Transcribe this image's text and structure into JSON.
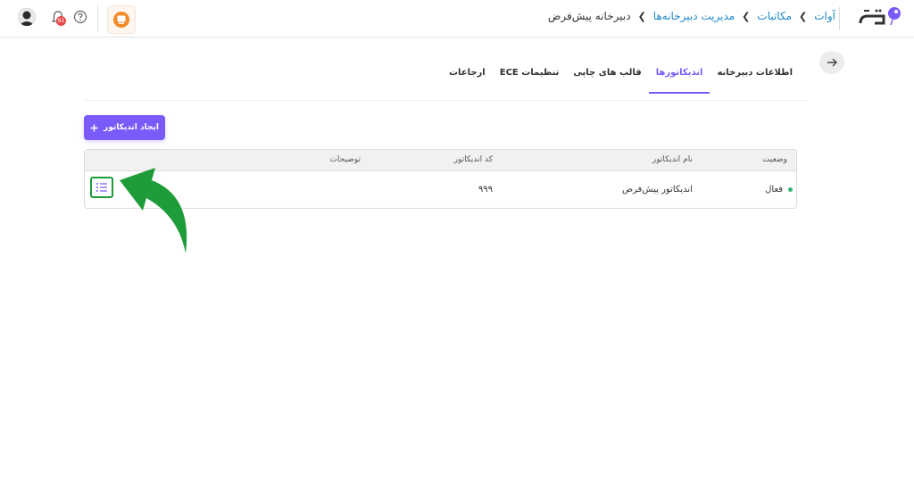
{
  "breadcrumb": {
    "items": [
      "آوات",
      "مکاتبات",
      "مدیریت دبیرخانه‌ها"
    ],
    "current": "دبیرخانه پیش‌فرض"
  },
  "header": {
    "notification_count": "91",
    "icons": {
      "avatar": "user-avatar",
      "bell": "bell-icon",
      "help": "question-circle-icon",
      "app": "app-launcher-icon"
    }
  },
  "tabs": [
    {
      "label": "اطلاعات دبیرخانه",
      "active": false
    },
    {
      "label": "اندیکاتورها",
      "active": true
    },
    {
      "label": "قالب های چاپی",
      "active": false
    },
    {
      "label": "تنظیمات ECE",
      "active": false
    },
    {
      "label": "ارجاعات",
      "active": false
    }
  ],
  "actions": {
    "create_label": "ایجاد اندیکاتور"
  },
  "table": {
    "headers": {
      "status": "وضعیت",
      "name": "نام اندیکاتور",
      "code": "کد اندیکاتور",
      "description": "توضیحات"
    },
    "rows": [
      {
        "status": "فعال",
        "name": "اندیکاتور پیش‌فرض",
        "code": "۹۹۹",
        "description": ""
      }
    ]
  },
  "colors": {
    "accent": "#7a5af8",
    "link": "#1e88c9",
    "active_status": "#34b36c",
    "highlight_arrow": "#1e9c3a"
  }
}
